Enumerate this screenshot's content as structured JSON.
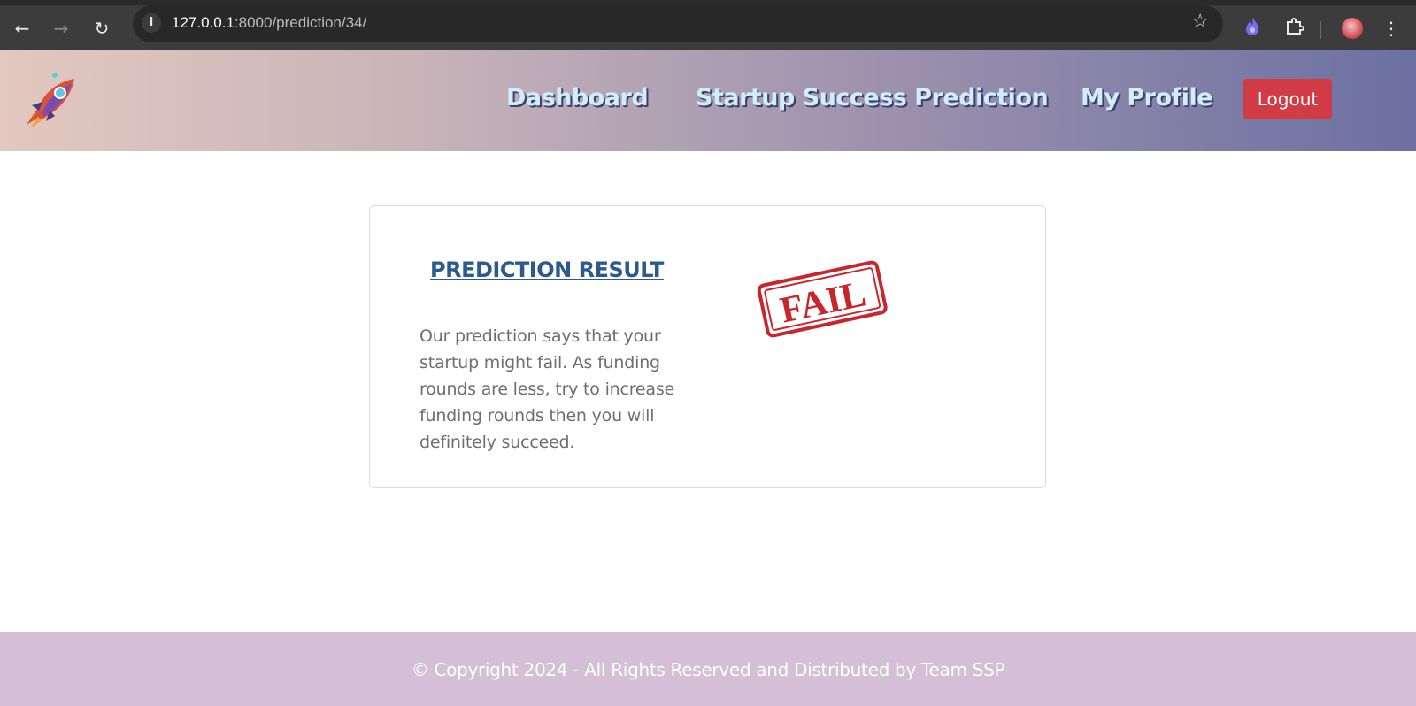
{
  "browser": {
    "url_host": "127.0.0.1",
    "url_rest": ":8000/prediction/34/"
  },
  "header": {
    "nav": {
      "dashboard": "Dashboard",
      "prediction": "Startup Success Prediction",
      "profile": "My Profile"
    },
    "logout_label": "Logout"
  },
  "card": {
    "title": "PREDICTION RESULT",
    "message": "Our prediction says that your startup might fail. As funding rounds are less, try to increase funding rounds then you will definitely succeed.",
    "stamp_text": "FAIL"
  },
  "footer": {
    "copyright": "© Copyright 2024 - All Rights Reserved and Distributed by Team SSP"
  },
  "colors": {
    "nav_text": "#cfeef9",
    "logout_bg": "#d13b45",
    "title": "#2c5a8e",
    "stamp": "#c8262d",
    "footer_bg": "#d4bfd6"
  },
  "icons": [
    "back-arrow-icon",
    "forward-arrow-icon",
    "reload-icon",
    "site-info-icon",
    "bookmark-star-icon",
    "extension-flame-icon",
    "extensions-puzzle-icon",
    "profile-avatar-icon",
    "menu-dots-icon",
    "rocket-logo-icon"
  ]
}
